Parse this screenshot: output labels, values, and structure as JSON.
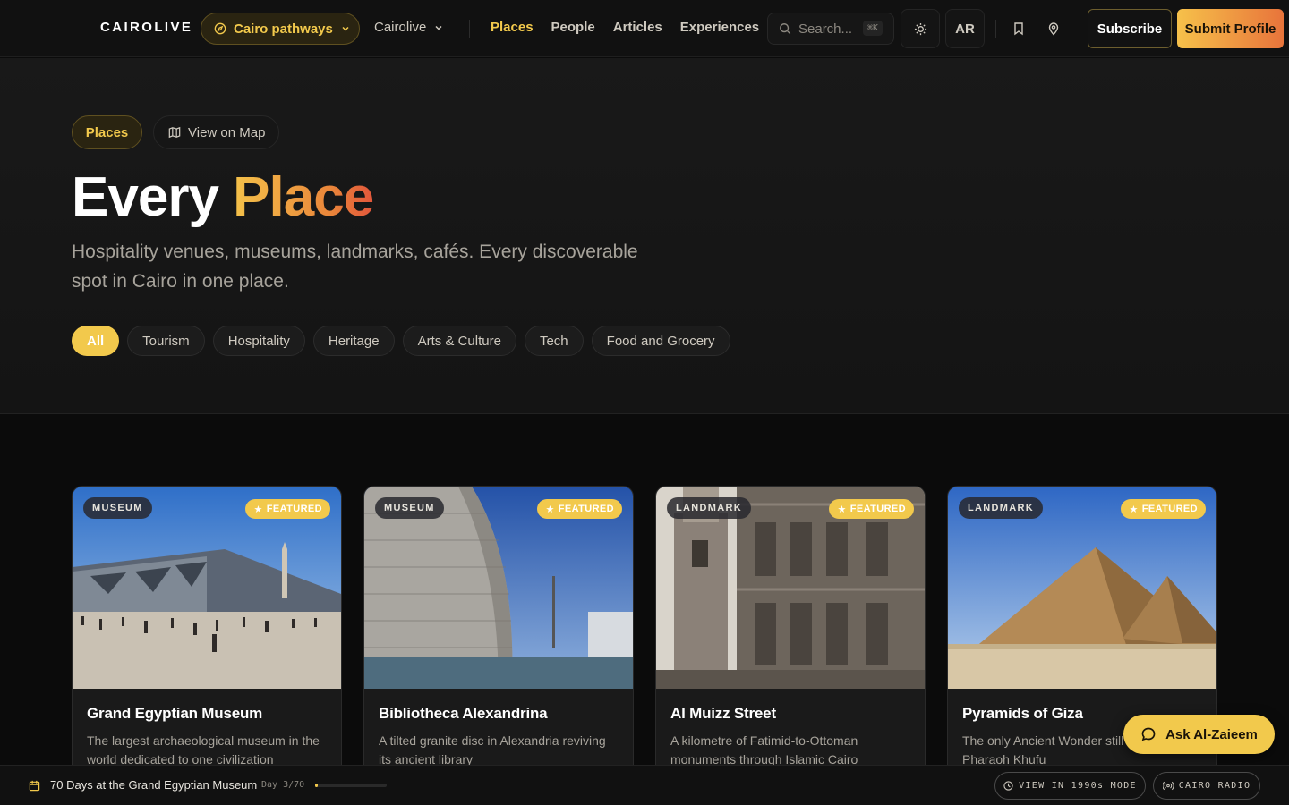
{
  "nav": {
    "logo": "CAIROLIVE",
    "pathways_label": "Cairo pathways",
    "brand_dropdown": "Cairolive",
    "links": [
      {
        "label": "Places",
        "active": true
      },
      {
        "label": "People",
        "active": false
      },
      {
        "label": "Articles",
        "active": false
      },
      {
        "label": "Experiences",
        "active": false
      }
    ],
    "search_placeholder": "Search...",
    "search_shortcut": "⌘K",
    "language": "AR",
    "subscribe_label": "Subscribe",
    "submit_label": "Submit Profile"
  },
  "hero": {
    "section_pill": "Places",
    "map_pill": "View on Map",
    "title_plain": "Every",
    "title_accent": "Place",
    "subtitle": "Hospitality venues, museums, landmarks, cafés. Every discoverable spot in Cairo in one place.",
    "filters": [
      {
        "label": "All",
        "active": true
      },
      {
        "label": "Tourism",
        "active": false
      },
      {
        "label": "Hospitality",
        "active": false
      },
      {
        "label": "Heritage",
        "active": false
      },
      {
        "label": "Arts & Culture",
        "active": false
      },
      {
        "label": "Tech",
        "active": false
      },
      {
        "label": "Food and Grocery",
        "active": false
      }
    ]
  },
  "cards": [
    {
      "type": "MUSEUM",
      "featured": "FEATURED",
      "title": "Grand Egyptian Museum",
      "desc": "The largest archaeological museum in the world dedicated to one civilization"
    },
    {
      "type": "MUSEUM",
      "featured": "FEATURED",
      "title": "Bibliotheca Alexandrina",
      "desc": "A tilted granite disc in Alexandria reviving its ancient library"
    },
    {
      "type": "LANDMARK",
      "featured": "FEATURED",
      "title": "Al Muizz Street",
      "desc": "A kilometre of Fatimid-to-Ottoman monuments through Islamic Cairo"
    },
    {
      "type": "LANDMARK",
      "featured": "FEATURED",
      "title": "Pyramids of Giza",
      "desc": "The only Ancient Wonder still built for Pharaoh Khufu"
    }
  ],
  "assistant": {
    "label": "Ask Al-Zaieem"
  },
  "bottom_bar": {
    "series_title": "70 Days at the Grand Egyptian Museum",
    "day_label": "Day 3/70",
    "progress": 0.043,
    "retro_label": "VIEW IN 1990s MODE",
    "radio_label": "CAIRO RADIO"
  },
  "colors": {
    "accent": "#f2c94c",
    "accent_gradient_end": "#e2563b",
    "background": "#0b0b0b"
  },
  "icons": [
    "compass-icon",
    "chevron-down-icon",
    "search-icon",
    "sun-icon",
    "bookmark-icon",
    "map-pin-icon",
    "map-icon",
    "star-icon",
    "chat-bubble-icon",
    "calendar-icon",
    "clock-icon",
    "radio-icon"
  ]
}
